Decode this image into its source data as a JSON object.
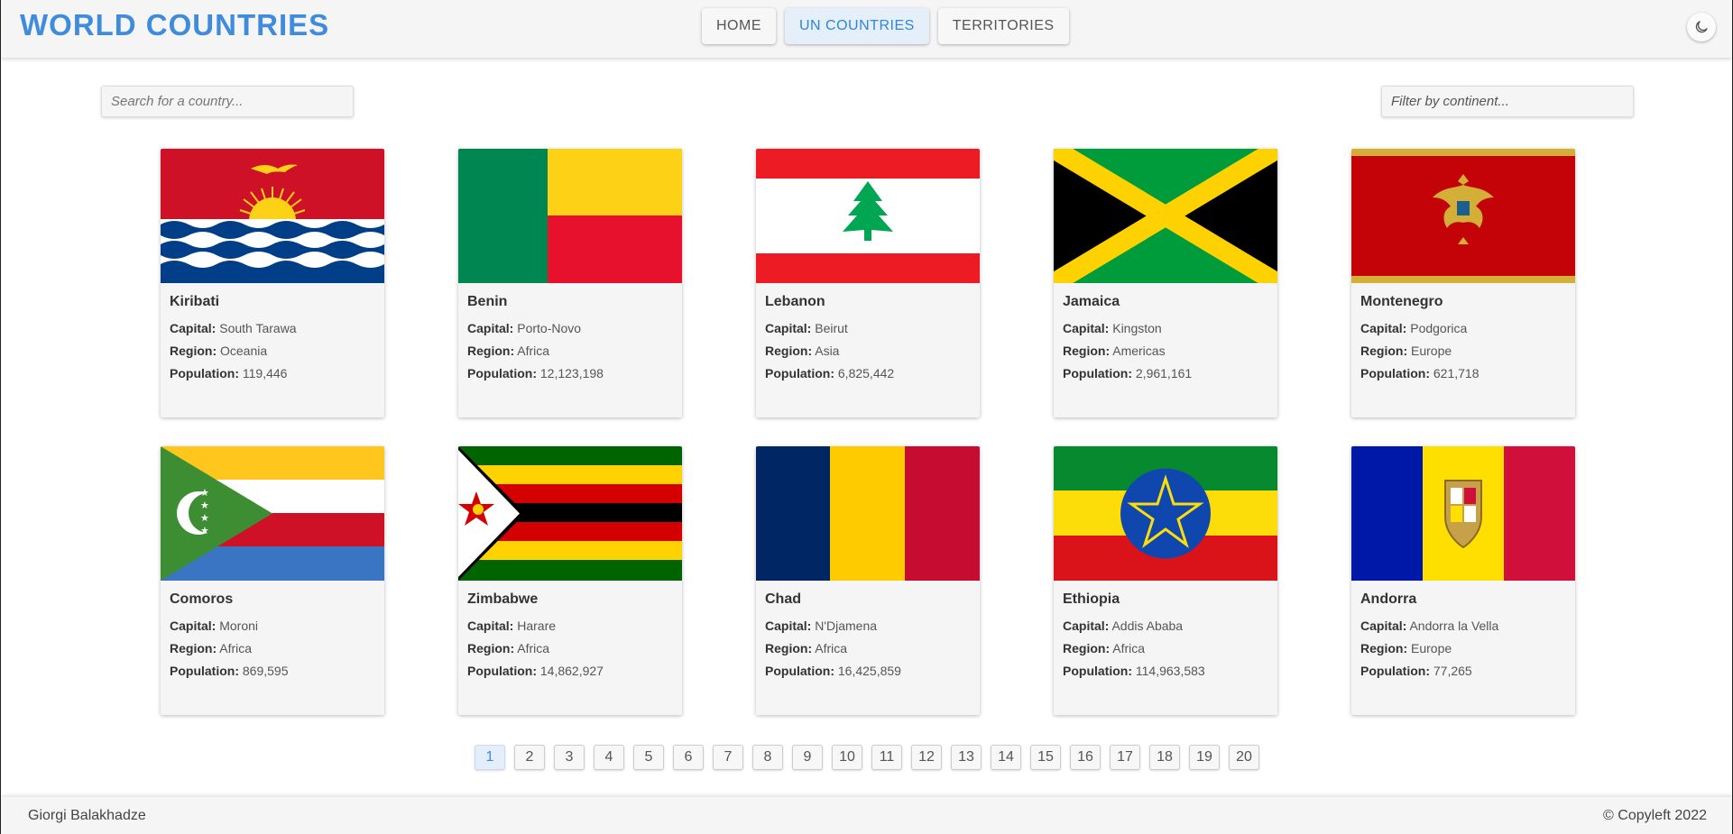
{
  "header": {
    "logo": "WORLD COUNTRIES",
    "nav": [
      {
        "label": "HOME",
        "active": false
      },
      {
        "label": "UN COUNTRIES",
        "active": true
      },
      {
        "label": "TERRITORIES",
        "active": false
      }
    ],
    "theme_icon": "moon-icon"
  },
  "search": {
    "placeholder": "Search for a country..."
  },
  "filter": {
    "placeholder": "Filter by continent..."
  },
  "labels": {
    "capital": "Capital:",
    "region": "Region:",
    "population": "Population:"
  },
  "countries": [
    {
      "name": "Kiribati",
      "capital": "South Tarawa",
      "region": "Oceania",
      "population": "119,446",
      "flag_icon": "kiribati-flag"
    },
    {
      "name": "Benin",
      "capital": "Porto-Novo",
      "region": "Africa",
      "population": "12,123,198",
      "flag_icon": "benin-flag"
    },
    {
      "name": "Lebanon",
      "capital": "Beirut",
      "region": "Asia",
      "population": "6,825,442",
      "flag_icon": "lebanon-flag"
    },
    {
      "name": "Jamaica",
      "capital": "Kingston",
      "region": "Americas",
      "population": "2,961,161",
      "flag_icon": "jamaica-flag"
    },
    {
      "name": "Montenegro",
      "capital": "Podgorica",
      "region": "Europe",
      "population": "621,718",
      "flag_icon": "montenegro-flag"
    },
    {
      "name": "Comoros",
      "capital": "Moroni",
      "region": "Africa",
      "population": "869,595",
      "flag_icon": "comoros-flag"
    },
    {
      "name": "Zimbabwe",
      "capital": "Harare",
      "region": "Africa",
      "population": "14,862,927",
      "flag_icon": "zimbabwe-flag"
    },
    {
      "name": "Chad",
      "capital": "N'Djamena",
      "region": "Africa",
      "population": "16,425,859",
      "flag_icon": "chad-flag"
    },
    {
      "name": "Ethiopia",
      "capital": "Addis Ababa",
      "region": "Africa",
      "population": "114,963,583",
      "flag_icon": "ethiopia-flag"
    },
    {
      "name": "Andorra",
      "capital": "Andorra la Vella",
      "region": "Europe",
      "population": "77,265",
      "flag_icon": "andorra-flag"
    }
  ],
  "pagination": {
    "pages": [
      "1",
      "2",
      "3",
      "4",
      "5",
      "6",
      "7",
      "8",
      "9",
      "10",
      "11",
      "12",
      "13",
      "14",
      "15",
      "16",
      "17",
      "18",
      "19",
      "20"
    ],
    "active": "1"
  },
  "footer": {
    "author": "Giorgi Balakhadze",
    "copyright": "© Copyleft 2022"
  },
  "colors": {
    "accent": "#3f8bdc",
    "card_bg": "#f5f5f5"
  }
}
